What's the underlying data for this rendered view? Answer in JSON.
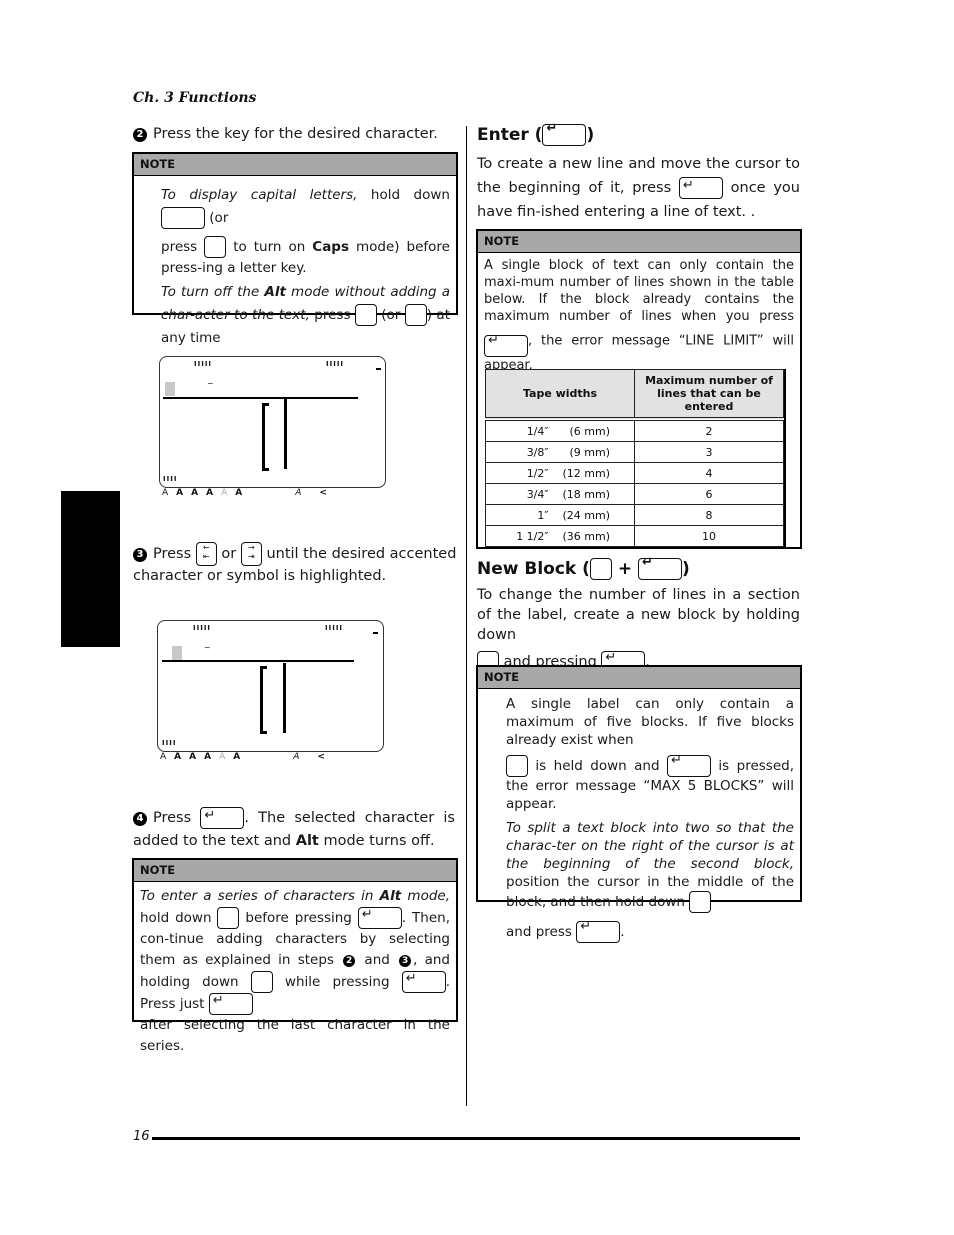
{
  "header": {
    "chapter": "Ch. 3 Functions"
  },
  "left": {
    "step2": {
      "num": "2",
      "text": "Press the key for the desired character."
    },
    "note1": {
      "title": "NOTE",
      "p1_italic": "To display capital letters,",
      "p1_a": " hold down ",
      "p1_b": " (or",
      "p1_c": "press ",
      "p1_d": " to turn on ",
      "p1_caps": "Caps",
      "p1_e": " mode) before press-ing a letter key.",
      "p2_italic_a": "To turn off the ",
      "p2_alt": "Alt",
      "p2_italic_b": " mode without adding a char-acter to the text,",
      "p2_a": " press ",
      "p2_b": " (or ",
      "p2_c": ") at any time"
    },
    "lcd_icons": [
      "A",
      "A",
      "A",
      "A",
      "A",
      "A",
      "A",
      "<"
    ],
    "lcd_ticks_left": "IIIII",
    "lcd_ticks_right": "IIIII",
    "lcd_ticks_bottom": "IIII",
    "lcd_tilde": "~",
    "step3": {
      "num": "3",
      "a": "Press ",
      "b": " or ",
      "c": " until the desired accented character or symbol is highlighted.",
      "key_left": "←\n|←",
      "key_right": "→\n→|"
    },
    "step4": {
      "num": "4",
      "a": "Press ",
      "b": ". The selected character is added to the text and ",
      "alt": "Alt",
      "c": " mode turns off."
    },
    "note2": {
      "title": "NOTE",
      "italic_a": "To enter a series of characters in ",
      "alt": "Alt",
      "italic_b": " mode,",
      "a": " hold down ",
      "b": " before pressing ",
      "c": ". Then, con-tinue adding characters by selecting them as explained in steps ",
      "s2": "2",
      "d": " and ",
      "s3": "3",
      "e": ", and holding down ",
      "f": " while pressing ",
      "g": ". Press just ",
      "h": "after selecting the last character in the series."
    }
  },
  "right": {
    "enter": {
      "title_a": "Enter (",
      "title_b": ")",
      "p_a": "To create a new line and move the cursor to the beginning of it, press ",
      "p_b": " once you have fin-ished entering a line of text. .",
      "note": {
        "title": "NOTE",
        "a": "A single block of text can only contain the maxi-mum number of lines shown in the table below. If the block already contains the maximum number of lines when you press ",
        "b": ", the error message “LINE LIMIT” will appear."
      },
      "table": {
        "headers": [
          "Tape widths",
          "Maximum number of lines that can be entered"
        ],
        "rows": [
          [
            "1/4″      (6 mm)",
            "2"
          ],
          [
            "3/8″      (9 mm)",
            "3"
          ],
          [
            "1/2″    (12 mm)",
            "4"
          ],
          [
            "3/4″    (18 mm)",
            "6"
          ],
          [
            "1″    (24 mm)",
            "8"
          ],
          [
            "1 1/2″    (36 mm)",
            "10"
          ]
        ]
      }
    },
    "newblock": {
      "title_a": "New Block (",
      "plus": "+",
      "title_b": ")",
      "p_a": "To change the number of lines in a section of the label, create a new block by holding down",
      "p_b": " and pressing ",
      "p_c": ".",
      "note": {
        "title": "NOTE",
        "a": "A single label can only contain a maximum of five blocks. If five blocks already exist when",
        "b": " is held down and ",
        "c": " is pressed, the error message “MAX 5 BLOCKS” will appear.",
        "italic": "To split a text block into two so that the charac-ter on the right of the cursor is at the beginning of the second block,",
        "d": " position the cursor in the middle of the block, and then hold down ",
        "e": "and press ",
        "f": "."
      }
    }
  },
  "footer": {
    "page": "16"
  }
}
